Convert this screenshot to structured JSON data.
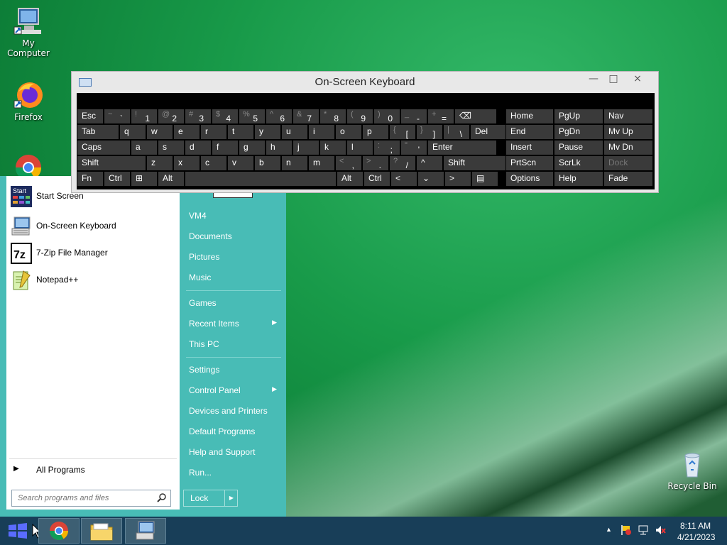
{
  "desktop": {
    "icons": [
      {
        "label": "My Computer"
      },
      {
        "label": "Firefox"
      },
      {
        "label": "Recycle Bin"
      }
    ]
  },
  "osk": {
    "title": "On-Screen Keyboard",
    "buttons": {
      "minimize": "—",
      "maximize": "□",
      "close": "×"
    },
    "row1": [
      {
        "main": "Esc"
      },
      {
        "shift": "~",
        "main": "`"
      },
      {
        "shift": "!",
        "main": "1"
      },
      {
        "shift": "@",
        "main": "2"
      },
      {
        "shift": "#",
        "main": "3"
      },
      {
        "shift": "$",
        "main": "4"
      },
      {
        "shift": "%",
        "main": "5"
      },
      {
        "shift": "^",
        "main": "6"
      },
      {
        "shift": "&",
        "main": "7"
      },
      {
        "shift": "*",
        "main": "8"
      },
      {
        "shift": "(",
        "main": "9"
      },
      {
        "shift": ")",
        "main": "0"
      },
      {
        "shift": "_",
        "main": "-"
      },
      {
        "shift": "+",
        "main": "="
      },
      {
        "main": "⌫"
      }
    ],
    "row2": [
      {
        "main": "Tab"
      },
      {
        "main": "q"
      },
      {
        "main": "w"
      },
      {
        "main": "e"
      },
      {
        "main": "r"
      },
      {
        "main": "t"
      },
      {
        "main": "y"
      },
      {
        "main": "u"
      },
      {
        "main": "i"
      },
      {
        "main": "o"
      },
      {
        "main": "p"
      },
      {
        "shift": "{",
        "main": "["
      },
      {
        "shift": "}",
        "main": "]"
      },
      {
        "shift": "|",
        "main": "\\"
      },
      {
        "main": "Del"
      }
    ],
    "row3": [
      {
        "main": "Caps"
      },
      {
        "main": "a"
      },
      {
        "main": "s"
      },
      {
        "main": "d"
      },
      {
        "main": "f"
      },
      {
        "main": "g"
      },
      {
        "main": "h"
      },
      {
        "main": "j"
      },
      {
        "main": "k"
      },
      {
        "main": "l"
      },
      {
        "shift": ":",
        "main": ";"
      },
      {
        "shift": "\"",
        "main": "'"
      },
      {
        "main": "Enter"
      }
    ],
    "row4": [
      {
        "main": "Shift"
      },
      {
        "main": "z"
      },
      {
        "main": "x"
      },
      {
        "main": "c"
      },
      {
        "main": "v"
      },
      {
        "main": "b"
      },
      {
        "main": "n"
      },
      {
        "main": "m"
      },
      {
        "shift": "<",
        "main": ","
      },
      {
        "shift": ">",
        "main": "."
      },
      {
        "shift": "?",
        "main": "/"
      },
      {
        "main": "^"
      },
      {
        "main": "Shift"
      }
    ],
    "row5": [
      {
        "main": "Fn"
      },
      {
        "main": "Ctrl"
      },
      {
        "main": "⊞"
      },
      {
        "main": "Alt"
      },
      {
        "main": ""
      },
      {
        "main": "Alt"
      },
      {
        "main": "Ctrl"
      },
      {
        "main": "<"
      },
      {
        "main": "⌄"
      },
      {
        "main": ">"
      },
      {
        "main": "▤"
      }
    ],
    "nav": [
      [
        "Home",
        "PgUp",
        "Nav"
      ],
      [
        "End",
        "PgDn",
        "Mv Up"
      ],
      [
        "Insert",
        "Pause",
        "Mv Dn"
      ],
      [
        "PrtScn",
        "ScrLk",
        "Dock"
      ],
      [
        "Options",
        "Help",
        "Fade"
      ]
    ]
  },
  "start_menu": {
    "programs": [
      "Start Screen",
      "On-Screen Keyboard",
      "7-Zip File Manager",
      "Notepad++"
    ],
    "all_programs": "All Programs",
    "search_placeholder": "Search programs and files",
    "right": {
      "user": "VM4",
      "documents": "Documents",
      "pictures": "Pictures",
      "music": "Music",
      "games": "Games",
      "recent_items": "Recent Items",
      "this_pc": "This PC",
      "settings": "Settings",
      "control_panel": "Control Panel",
      "devices_printers": "Devices and Printers",
      "default_programs": "Default Programs",
      "help_support": "Help and Support",
      "run": "Run..."
    },
    "lock_label": "Lock"
  },
  "taskbar": {
    "time": "8:11 AM",
    "date": "4/21/2023"
  },
  "icons": {
    "osk_titlebar": "keyboard-icon",
    "start": "windows-logo-icon",
    "chrome": "chrome-icon",
    "explorer": "folder-icon"
  }
}
